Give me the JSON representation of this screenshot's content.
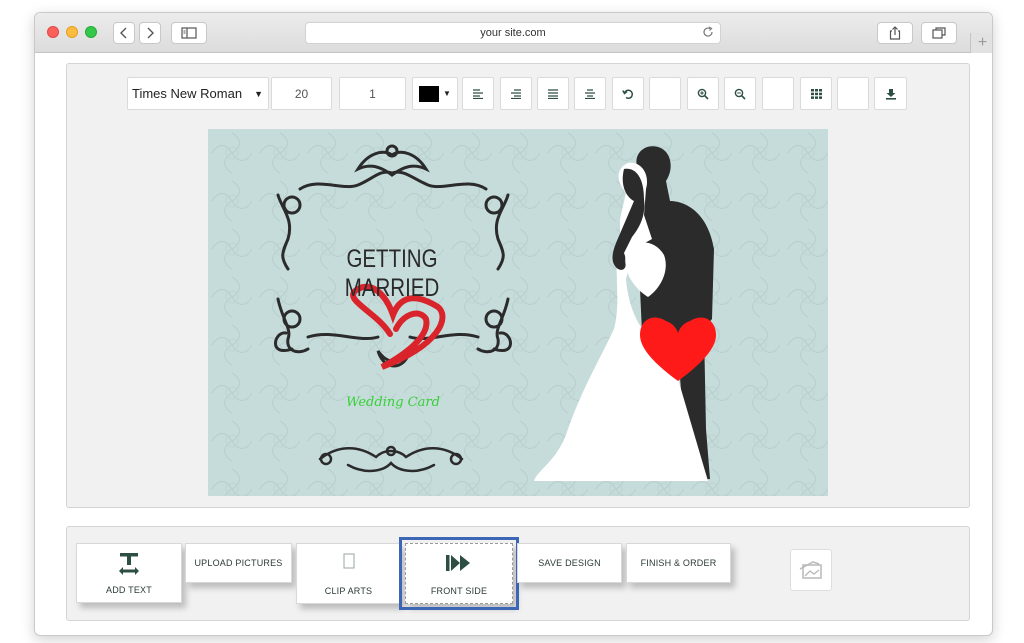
{
  "browser": {
    "url": "your site.com",
    "back_icon": "chevron-left-icon",
    "forward_icon": "chevron-right-icon",
    "sidebar_icon": "sidebar-icon",
    "share_icon": "share-icon",
    "tabs_icon": "tabs-icon",
    "reload_icon": "reload-icon",
    "new_tab_symbol": "+"
  },
  "toolbar": {
    "font_family": "Times New Roman",
    "font_size": "20",
    "line_height": "1",
    "text_color": "#000000",
    "icons": [
      "align-left-icon",
      "align-right-icon",
      "justify-icon",
      "align-center-icon",
      "rotate-icon",
      "zoom-in-icon",
      "zoom-out-icon",
      "grid-icon",
      "download-icon"
    ]
  },
  "card": {
    "title": "GETTING MARRIED",
    "subtitle": "Wedding Card",
    "background_color": "#c6dcdb",
    "heart_color": "#ff1a1a",
    "ribbon_color": "#d8242a",
    "script_color": "#35d135"
  },
  "actions": {
    "add_text": "ADD TEXT",
    "upload_pictures": "UPLOAD PICTURES",
    "clip_arts": "CLIP ARTS",
    "front_side": "FRONT SIDE",
    "save_design": "SAVE DESIGN",
    "finish_order": "FINISH & ORDER",
    "selected": "FRONT SIDE",
    "accent_color": "#2d4f43",
    "selection_color": "#3d66b5"
  }
}
